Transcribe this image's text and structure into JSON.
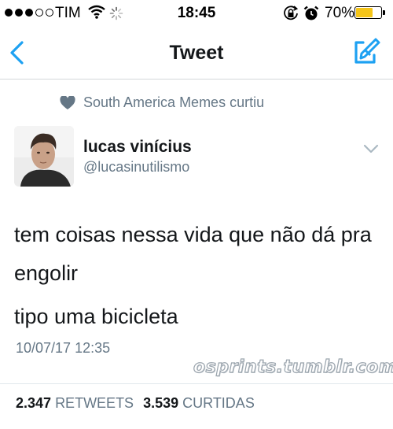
{
  "status_bar": {
    "carrier": "TIM",
    "time": "18:45",
    "battery_percent": "70%",
    "battery_level": 0.7,
    "signal_bars_filled": 3,
    "signal_bars_total": 5
  },
  "nav": {
    "title": "Tweet",
    "back_icon": "chevron-left-icon",
    "compose_icon": "compose-icon"
  },
  "social_context": {
    "text": "South America Memes curtiu",
    "icon": "heart-icon"
  },
  "author": {
    "name": "lucas vinícius",
    "handle": "@lucasinutilismo"
  },
  "tweet": {
    "lines": [
      "tem coisas nessa vida que não dá pra engolir",
      "tipo uma bicicleta"
    ],
    "timestamp": "10/07/17 12:35"
  },
  "watermark": "osprints.tumblr.com",
  "stats": {
    "retweets_count": "2.347",
    "retweets_label": "RETWEETS",
    "likes_count": "3.539",
    "likes_label": "CURTIDAS"
  },
  "colors": {
    "accent": "#1da1f2",
    "secondary_text": "#657786",
    "primary_text": "#14171a",
    "battery": "#f5c518"
  }
}
